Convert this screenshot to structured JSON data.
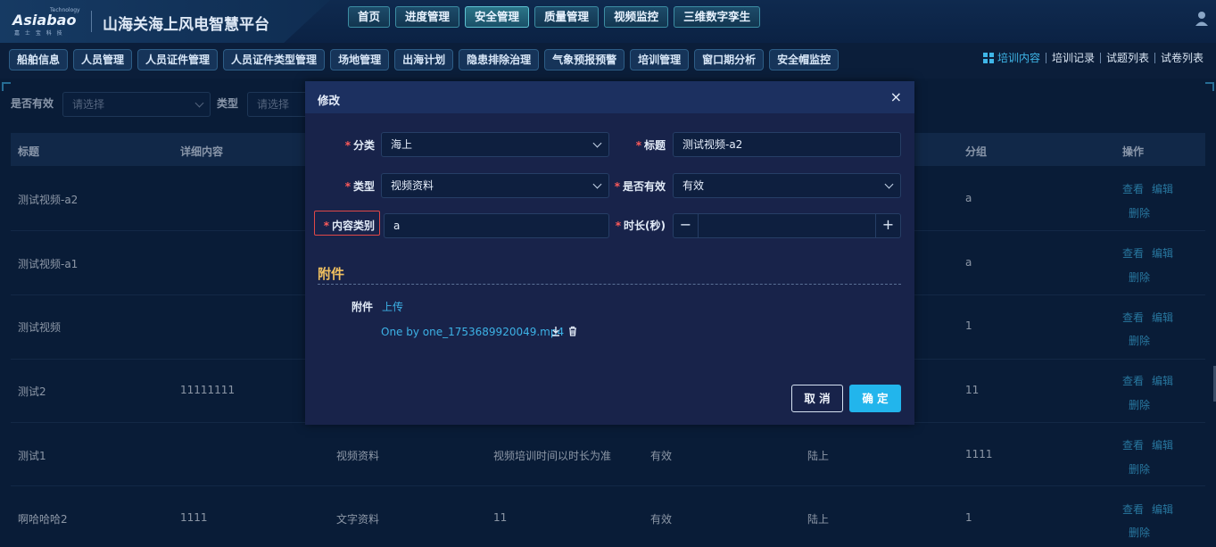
{
  "app": {
    "logo_tag": "Technology",
    "logo_text": "Asiabao",
    "logo_sub": "嘉 士 宝 科 技",
    "title": "山海关海上风电智慧平台"
  },
  "topnav": [
    {
      "label": "首页",
      "active": false
    },
    {
      "label": "进度管理",
      "active": false
    },
    {
      "label": "安全管理",
      "active": true
    },
    {
      "label": "质量管理",
      "active": false
    },
    {
      "label": "视频监控",
      "active": false
    },
    {
      "label": "三维数字孪生",
      "active": false
    }
  ],
  "subnav": [
    "船舶信息",
    "人员管理",
    "人员证件管理",
    "人员证件类型管理",
    "场地管理",
    "出海计划",
    "隐患排除治理",
    "气象预报预警",
    "培训管理",
    "窗口期分析",
    "安全帽监控"
  ],
  "right_tabs": [
    "培训内容",
    "培训记录",
    "试题列表",
    "试卷列表"
  ],
  "filters": {
    "valid_label": "是否有效",
    "valid_placeholder": "请选择",
    "type_label": "类型",
    "type_placeholder": "请选择"
  },
  "table": {
    "headers": [
      "标题",
      "详细内容",
      "分组",
      "操作"
    ],
    "rows": [
      {
        "title": "测试视频-a2",
        "detail": "",
        "type": "",
        "note": "",
        "valid": "",
        "category": "",
        "group": "a"
      },
      {
        "title": "测试视频-a1",
        "detail": "",
        "type": "",
        "note": "",
        "valid": "",
        "category": "",
        "group": "a"
      },
      {
        "title": "测试视频",
        "detail": "",
        "type": "",
        "note": "",
        "valid": "",
        "category": "",
        "group": "1"
      },
      {
        "title": "测试2",
        "detail": "11111111",
        "type": "",
        "note": "",
        "valid": "",
        "category": "",
        "group": "11"
      },
      {
        "title": "测试1",
        "detail": "",
        "type": "视频资料",
        "note": "视频培训时间以时长为准",
        "valid": "有效",
        "category": "陆上",
        "group": "1111"
      },
      {
        "title": "啊哈哈哈2",
        "detail": "1111",
        "type": "文字资料",
        "note": "11",
        "valid": "有效",
        "category": "陆上",
        "group": "1"
      }
    ],
    "ops": {
      "view": "查看",
      "edit": "编辑",
      "delete": "删除"
    }
  },
  "modal": {
    "title": "修改",
    "close": "×",
    "fields": {
      "category_label": "分类",
      "category_value": "海上",
      "title_label": "标题",
      "title_value": "测试视频-a2",
      "type_label": "类型",
      "type_value": "视频资料",
      "valid_label": "是否有效",
      "valid_value": "有效",
      "content_label": "内容类别",
      "content_value": "a",
      "duration_label": "时长(秒)",
      "duration_minus": "−",
      "duration_plus": "+",
      "duration_value": ""
    },
    "required_mark": "*",
    "section_title": "附件",
    "attachment_label": "附件",
    "upload": "上传",
    "file_name": "One by one_1753689920049.mp4",
    "cancel": "取 消",
    "confirm": "确 定"
  }
}
